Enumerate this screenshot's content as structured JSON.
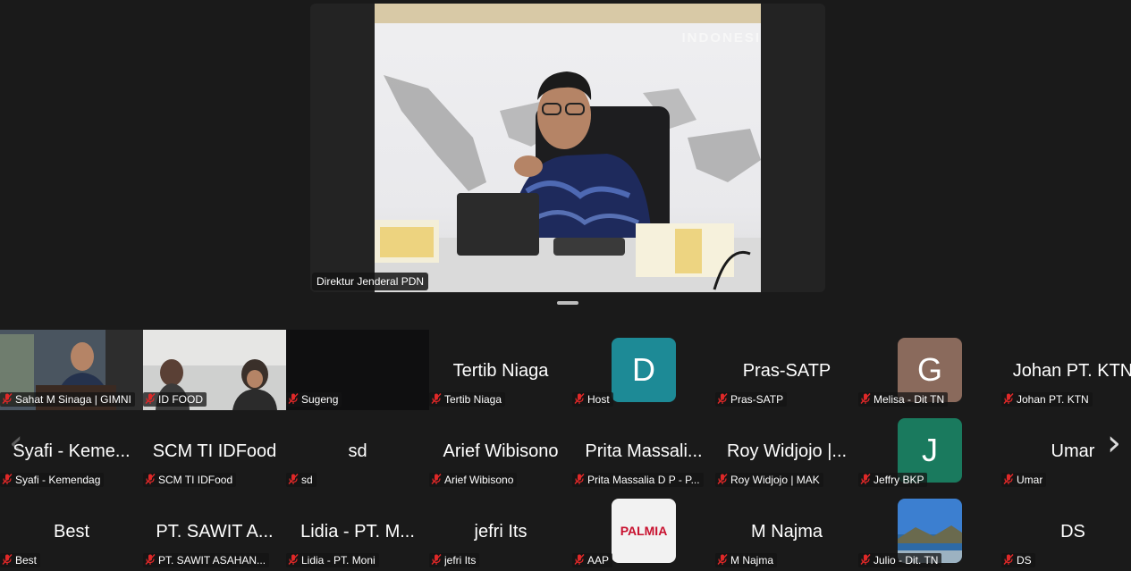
{
  "active_speaker": {
    "label": "Direktur Jenderal PDN",
    "background_text": "INDONESI"
  },
  "participants": [
    {
      "display": "photo",
      "tile_name": "",
      "label": "Sahat M Sinaga | GIMNI"
    },
    {
      "display": "photo",
      "tile_name": "",
      "label": "ID FOOD"
    },
    {
      "display": "dark",
      "tile_name": "",
      "label": "Sugeng"
    },
    {
      "display": "name",
      "tile_name": "Tertib Niaga",
      "label": "Tertib Niaga"
    },
    {
      "display": "letter",
      "letter": "D",
      "color": "#1d8a96",
      "label": "Host"
    },
    {
      "display": "name",
      "tile_name": "Pras-SATP",
      "label": "Pras-SATP"
    },
    {
      "display": "letter",
      "letter": "G",
      "color": "#8a6a5c",
      "label": "Melisa - Dit TN"
    },
    {
      "display": "name",
      "tile_name": "Johan PT. KTN",
      "label": "Johan PT. KTN"
    },
    {
      "display": "name",
      "tile_name": "Syafi - Keme...",
      "label": "Syafi - Kemendag"
    },
    {
      "display": "name",
      "tile_name": "SCM TI IDFood",
      "label": "SCM TI IDFood"
    },
    {
      "display": "name",
      "tile_name": "sd",
      "label": "sd"
    },
    {
      "display": "name",
      "tile_name": "Arief Wibisono",
      "label": "Arief Wibisono"
    },
    {
      "display": "name",
      "tile_name": "Prita Massali...",
      "label": "Prita Massalia D P - P..."
    },
    {
      "display": "name",
      "tile_name": "Roy Widjojo |...",
      "label": "Roy Widjojo | MAK"
    },
    {
      "display": "letter",
      "letter": "J",
      "color": "#1a7a5e",
      "label": "Jeffry BKP"
    },
    {
      "display": "name",
      "tile_name": "Umar",
      "label": "Umar"
    },
    {
      "display": "name",
      "tile_name": "Best",
      "label": "Best"
    },
    {
      "display": "name",
      "tile_name": "PT. SAWIT A...",
      "label": "PT. SAWIT ASAHAN..."
    },
    {
      "display": "name",
      "tile_name": "Lidia - PT. M...",
      "label": "Lidia - PT. Moni"
    },
    {
      "display": "name",
      "tile_name": "jefri Its",
      "label": "jefri Its"
    },
    {
      "display": "logo",
      "logo_text": "PALMIA",
      "label": "AAP"
    },
    {
      "display": "name",
      "tile_name": "M Najma",
      "label": "M Najma"
    },
    {
      "display": "scenery",
      "label": "Julio - Dit. TN"
    },
    {
      "display": "name",
      "tile_name": "DS",
      "label": "DS"
    }
  ],
  "nav": {
    "prev": "‹",
    "next": "›"
  },
  "colors": {
    "muted_mic": "#e02828",
    "background": "#1a1a1a"
  }
}
